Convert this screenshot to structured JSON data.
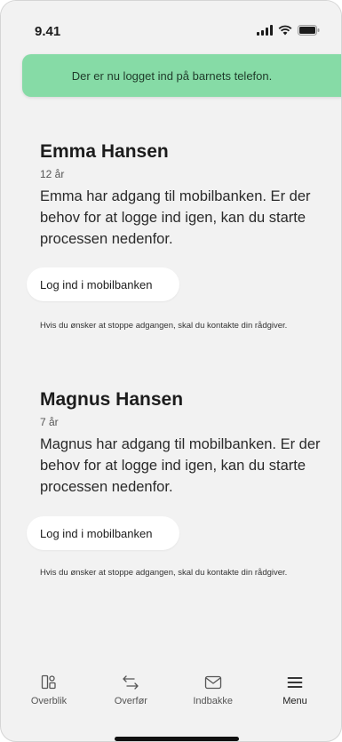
{
  "status": {
    "time": "9.41"
  },
  "toast": {
    "message": "Der er nu logget ind på barnets telefon."
  },
  "children": [
    {
      "name": "Emma Hansen",
      "age": "12 år",
      "description": "Emma har adgang til mobilbanken. Er der behov for at logge ind igen, kan du starte processen nedenfor.",
      "login_label": "Log ind i mobilbanken",
      "stop_note": "Hvis du ønsker at stoppe adgangen, skal du kontakte din rådgiver."
    },
    {
      "name": "Magnus Hansen",
      "age": "7 år",
      "description": "Magnus har adgang til mobilbanken. Er der behov for at logge ind igen, kan du starte processen nedenfor.",
      "login_label": "Log ind i mobilbanken",
      "stop_note": "Hvis du ønsker at stoppe adgangen, skal du kontakte din rådgiver."
    }
  ],
  "tabbar": {
    "items": [
      {
        "label": "Overblik",
        "icon": "overview-icon"
      },
      {
        "label": "Overfør",
        "icon": "transfer-arrows-icon"
      },
      {
        "label": "Indbakke",
        "icon": "envelope-icon"
      },
      {
        "label": "Menu",
        "icon": "hamburger-menu-icon"
      }
    ]
  },
  "colors": {
    "background": "#f2f2f2",
    "toast": "#86dba6",
    "text": "#1c1c1c",
    "button": "#ffffff"
  }
}
